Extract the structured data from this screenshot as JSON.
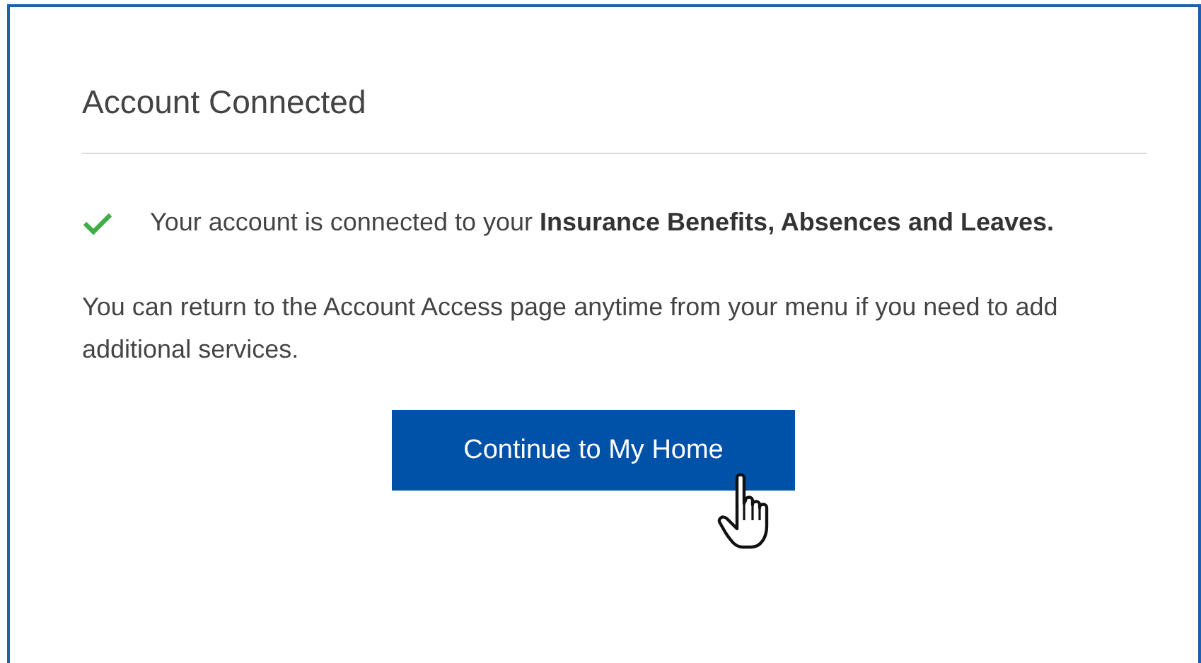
{
  "title": "Account Connected",
  "message": "Your account is connected to your **Insurance Benefits, Absences and Leaves.**",
  "note": "You can return to the Account Access page anytime from your menu if you need to add additional services.",
  "button": {
    "label": "Continue to My Home"
  }
}
